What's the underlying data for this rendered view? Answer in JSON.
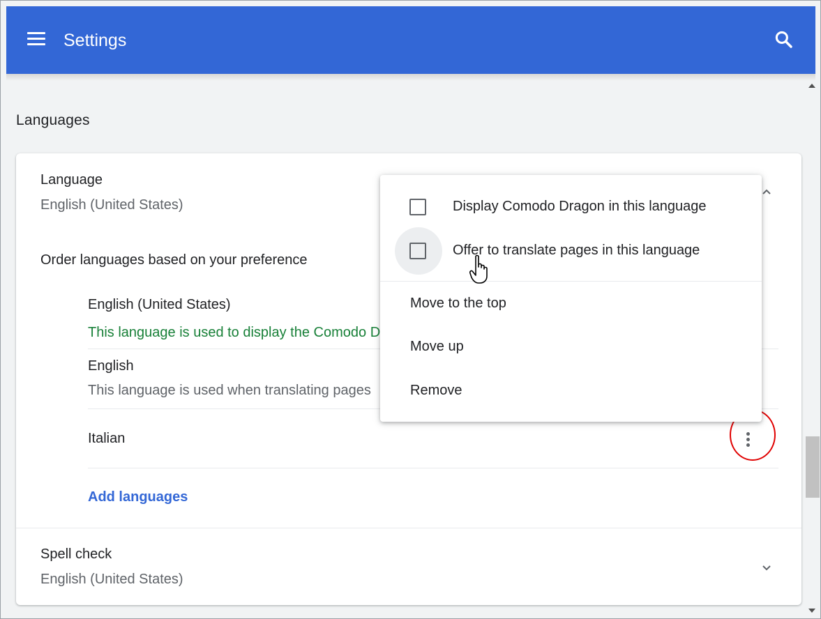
{
  "header": {
    "title": "Settings",
    "menu_icon": "hamburger-icon",
    "search_icon": "search-icon"
  },
  "section": {
    "title": "Languages"
  },
  "language": {
    "label": "Language",
    "value": "English (United States)",
    "order_label": "Order languages based on your preference",
    "items": [
      {
        "name": "English (United States)",
        "note": "This language is used to display the Comodo Dragon UI"
      },
      {
        "name": "English",
        "note": "This language is used when translating pages"
      },
      {
        "name": "Italian",
        "note": ""
      }
    ],
    "add_label": "Add languages"
  },
  "spell_check": {
    "label": "Spell check",
    "value": "English (United States)"
  },
  "menu": {
    "display_option": "Display Comodo Dragon in this language",
    "translate_option": "Offer to translate pages in this language",
    "move_top": "Move to the top",
    "move_up": "Move up",
    "remove": "Remove"
  },
  "colors": {
    "header": "#3367d6",
    "link": "#3367d6",
    "note_green": "#188038",
    "highlight": "#e00000"
  }
}
